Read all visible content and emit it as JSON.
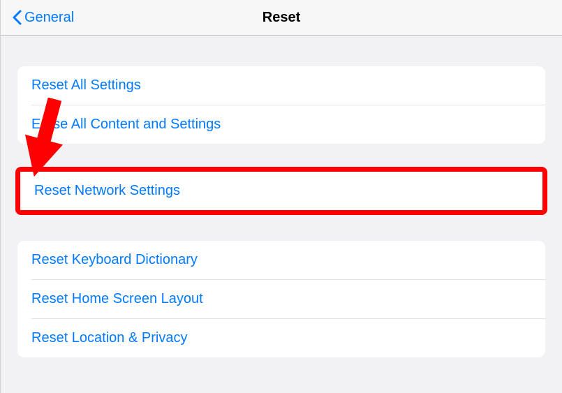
{
  "nav": {
    "back_label": "General",
    "title": "Reset"
  },
  "groups": [
    {
      "items": [
        {
          "label": "Reset All Settings"
        },
        {
          "label": "Erase All Content and Settings"
        }
      ]
    },
    {
      "highlighted": true,
      "items": [
        {
          "label": "Reset Network Settings"
        }
      ]
    },
    {
      "items": [
        {
          "label": "Reset Keyboard Dictionary"
        },
        {
          "label": "Reset Home Screen Layout"
        },
        {
          "label": "Reset Location & Privacy"
        }
      ]
    }
  ],
  "annotation": {
    "arrow_color": "#ff0000",
    "highlight_color": "#ff0000"
  }
}
